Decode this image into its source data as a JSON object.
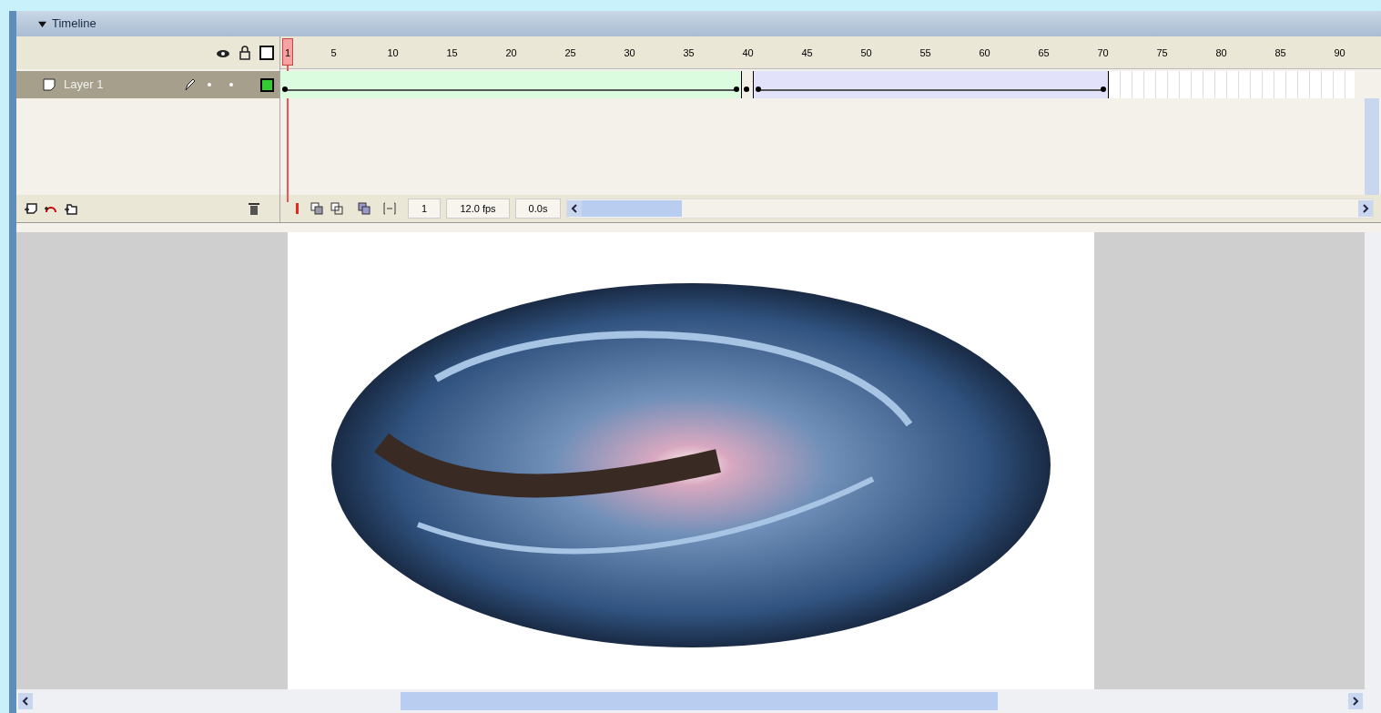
{
  "panel": {
    "title": "Timeline",
    "expanded": true
  },
  "ruler": {
    "playhead": "1",
    "labels": [
      "5",
      "10",
      "15",
      "20",
      "25",
      "30",
      "35",
      "40",
      "45",
      "50",
      "55",
      "60",
      "65",
      "70",
      "75",
      "80",
      "85",
      "90"
    ]
  },
  "layers": [
    {
      "name": "Layer 1",
      "selected": true,
      "spans": [
        {
          "kind": "motion"
        },
        {
          "kind": "keyframe"
        },
        {
          "kind": "shape"
        }
      ]
    }
  ],
  "status": {
    "current_frame": "1",
    "frame_rate": "12.0 fps",
    "elapsed_time": "0.0s"
  }
}
